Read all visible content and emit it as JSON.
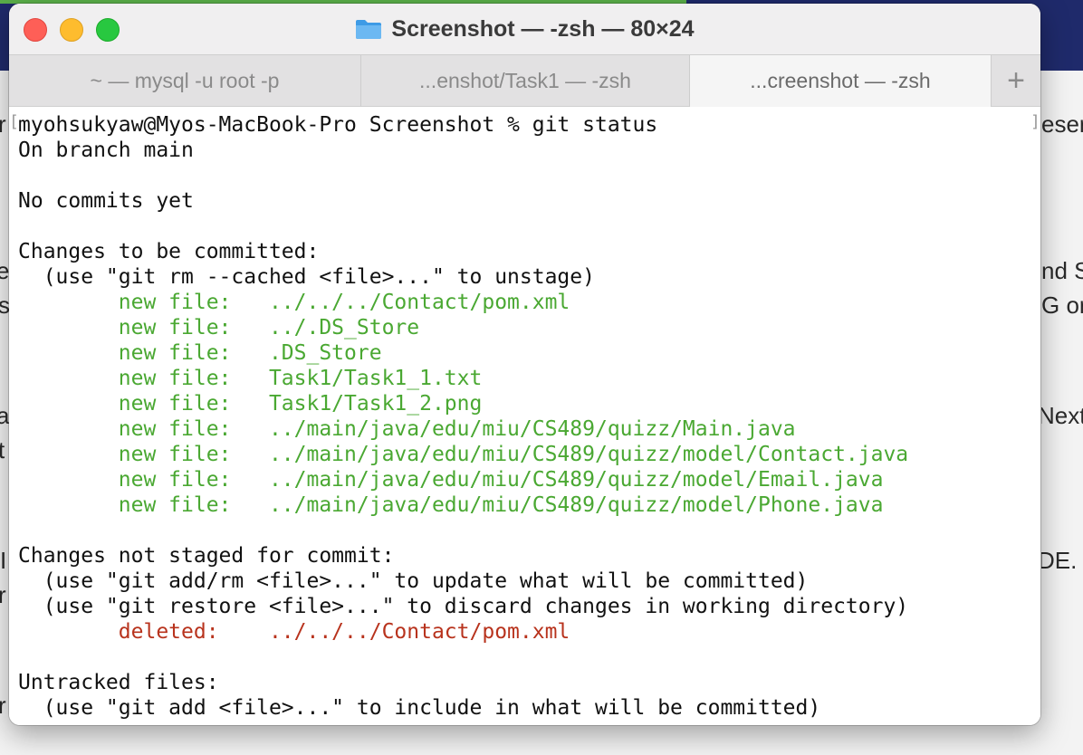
{
  "background": {
    "left_fragments": [
      "r",
      "e",
      "s",
      "a",
      "t",
      "I",
      "r",
      "r"
    ],
    "right_fragments": [
      "eser",
      "nd S",
      "G or",
      "Next",
      "DE. B"
    ]
  },
  "window": {
    "title": "Screenshot — -zsh — 80×24",
    "folder_icon": "folder-icon"
  },
  "tabs": [
    {
      "label": "~ — mysql -u root -p"
    },
    {
      "label": "...enshot/Task1 — -zsh"
    },
    {
      "label": "...creenshot — -zsh"
    }
  ],
  "new_tab_label": "+",
  "terminal": {
    "lines": [
      {
        "text": "myohsukyaw@Myos-MacBook-Pro Screenshot % git status",
        "color": "default"
      },
      {
        "text": "On branch main",
        "color": "default"
      },
      {
        "text": "",
        "color": "default"
      },
      {
        "text": "No commits yet",
        "color": "default"
      },
      {
        "text": "",
        "color": "default"
      },
      {
        "text": "Changes to be committed:",
        "color": "default"
      },
      {
        "text": "  (use \"git rm --cached <file>...\" to unstage)",
        "color": "default"
      },
      {
        "text": "        new file:   ../../../Contact/pom.xml",
        "color": "green"
      },
      {
        "text": "        new file:   ../.DS_Store",
        "color": "green"
      },
      {
        "text": "        new file:   .DS_Store",
        "color": "green"
      },
      {
        "text": "        new file:   Task1/Task1_1.txt",
        "color": "green"
      },
      {
        "text": "        new file:   Task1/Task1_2.png",
        "color": "green"
      },
      {
        "text": "        new file:   ../main/java/edu/miu/CS489/quizz/Main.java",
        "color": "green"
      },
      {
        "text": "        new file:   ../main/java/edu/miu/CS489/quizz/model/Contact.java",
        "color": "green"
      },
      {
        "text": "        new file:   ../main/java/edu/miu/CS489/quizz/model/Email.java",
        "color": "green"
      },
      {
        "text": "        new file:   ../main/java/edu/miu/CS489/quizz/model/Phone.java",
        "color": "green"
      },
      {
        "text": "",
        "color": "default"
      },
      {
        "text": "Changes not staged for commit:",
        "color": "default"
      },
      {
        "text": "  (use \"git add/rm <file>...\" to update what will be committed)",
        "color": "default"
      },
      {
        "text": "  (use \"git restore <file>...\" to discard changes in working directory)",
        "color": "default"
      },
      {
        "text": "        deleted:    ../../../Contact/pom.xml",
        "color": "red"
      },
      {
        "text": "",
        "color": "default"
      },
      {
        "text": "Untracked files:",
        "color": "default"
      },
      {
        "text": "  (use \"git add <file>...\" to include in what will be committed)",
        "color": "default"
      }
    ],
    "colors": {
      "default": "#111111",
      "green": "#4aa832",
      "red": "#b8331d"
    }
  }
}
